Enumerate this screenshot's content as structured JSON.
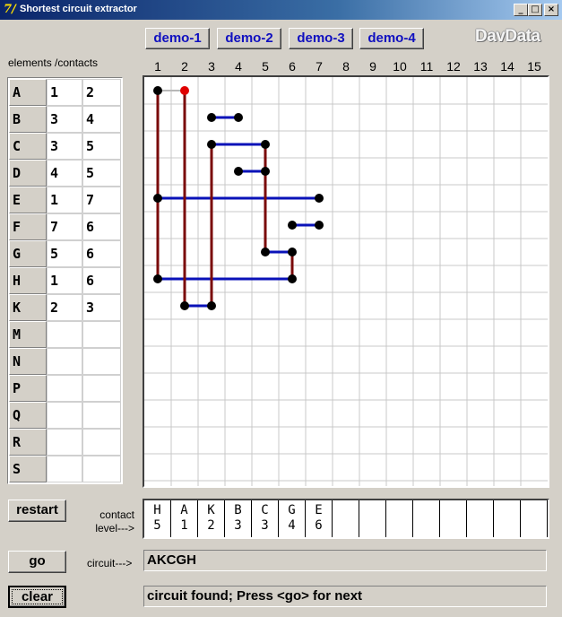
{
  "window": {
    "title": "Shortest circuit extractor",
    "icon": "7/",
    "min": "_",
    "max": "□",
    "close": "×"
  },
  "demos": [
    "demo-1",
    "demo-2",
    "demo-3",
    "demo-4"
  ],
  "logo": "DavData",
  "elements_label": "elements /contacts",
  "elements": [
    {
      "name": "A",
      "c1": "1",
      "c2": "2"
    },
    {
      "name": "B",
      "c1": "3",
      "c2": "4"
    },
    {
      "name": "C",
      "c1": "3",
      "c2": "5"
    },
    {
      "name": "D",
      "c1": "4",
      "c2": "5"
    },
    {
      "name": "E",
      "c1": "1",
      "c2": "7"
    },
    {
      "name": "F",
      "c1": "7",
      "c2": "6"
    },
    {
      "name": "G",
      "c1": "5",
      "c2": "6"
    },
    {
      "name": "H",
      "c1": "1",
      "c2": "6"
    },
    {
      "name": "K",
      "c1": "2",
      "c2": "3"
    },
    {
      "name": "M",
      "c1": "",
      "c2": ""
    },
    {
      "name": "N",
      "c1": "",
      "c2": ""
    },
    {
      "name": "P",
      "c1": "",
      "c2": ""
    },
    {
      "name": "Q",
      "c1": "",
      "c2": ""
    },
    {
      "name": "R",
      "c1": "",
      "c2": ""
    },
    {
      "name": "S",
      "c1": "",
      "c2": ""
    }
  ],
  "columns": [
    "1",
    "2",
    "3",
    "4",
    "5",
    "6",
    "7",
    "8",
    "9",
    "10",
    "11",
    "12",
    "13",
    "14",
    "15"
  ],
  "colors": {
    "horizontal": "#0a12b8",
    "vertical": "#7a0a0a",
    "node": "#000000",
    "active_node": "#e00000",
    "gray_segment": "#b8b8b8"
  },
  "buttons": {
    "restart": "restart",
    "go": "go",
    "clear": "clear"
  },
  "contact_label_1": "contact",
  "contact_label_2": "level--->",
  "levels": [
    {
      "el": "H",
      "lv": "5"
    },
    {
      "el": "A",
      "lv": "1"
    },
    {
      "el": "K",
      "lv": "2"
    },
    {
      "el": "B",
      "lv": "3"
    },
    {
      "el": "C",
      "lv": "3"
    },
    {
      "el": "G",
      "lv": "4"
    },
    {
      "el": "E",
      "lv": "6"
    },
    {
      "el": "",
      "lv": ""
    },
    {
      "el": "",
      "lv": ""
    },
    {
      "el": "",
      "lv": ""
    },
    {
      "el": "",
      "lv": ""
    },
    {
      "el": "",
      "lv": ""
    },
    {
      "el": "",
      "lv": ""
    },
    {
      "el": "",
      "lv": ""
    },
    {
      "el": "",
      "lv": ""
    }
  ],
  "circuit_label": "circuit--->",
  "circuit": "AKCGH",
  "status": "circuit found; Press <go> for next"
}
